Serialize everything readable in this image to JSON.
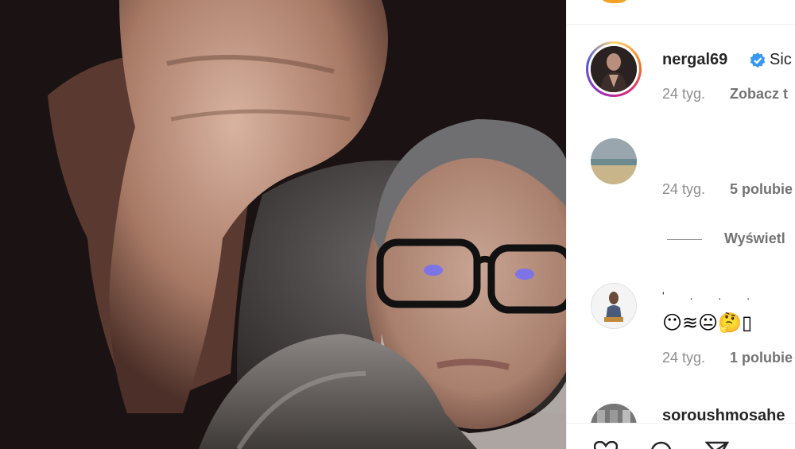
{
  "post": {
    "author": "nergal69",
    "verified": true,
    "caption_start": "Sic",
    "age": "24 tyg.",
    "see_translation": "Zobacz t"
  },
  "comments": [
    {
      "age": "24 tyg.",
      "likes": "5 polubie"
    },
    {
      "username_hidden": "' . . .",
      "text": "😶≋😐🤔▯",
      "age": "24 tyg.",
      "likes": "1 polubie"
    },
    {
      "username": "soroushmosahe"
    }
  ],
  "view_replies": "Wyświetl",
  "colors": {
    "verified_blue": "#3897f0",
    "text_primary": "#262626",
    "text_secondary": "#8e8e8e",
    "story_ring": "#d62976"
  },
  "icons": [
    "verified-badge-icon",
    "heart-icon",
    "comment-icon",
    "share-icon"
  ]
}
